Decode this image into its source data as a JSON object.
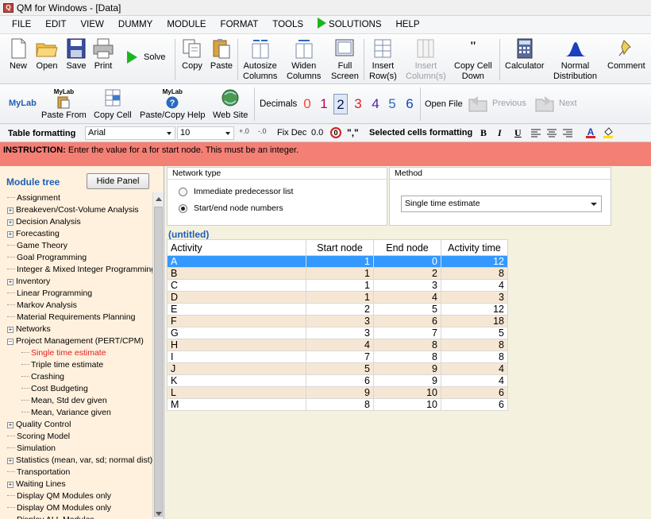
{
  "window": {
    "title": "QM for Windows - [Data]"
  },
  "menu": [
    "FILE",
    "EDIT",
    "VIEW",
    "DUMMY",
    "MODULE",
    "FORMAT",
    "TOOLS",
    "SOLUTIONS",
    "HELP"
  ],
  "toolbar": {
    "new": "New",
    "open": "Open",
    "save": "Save",
    "print": "Print",
    "solve": "Solve",
    "copy": "Copy",
    "paste": "Paste",
    "autosize": [
      "Autosize",
      "Columns"
    ],
    "widen": [
      "Widen",
      "Columns"
    ],
    "full": [
      "Full",
      "Screen"
    ],
    "insert_row": [
      "Insert",
      "Row(s)"
    ],
    "insert_col": [
      "Insert",
      "Column(s)"
    ],
    "copy_down": [
      "Copy Cell",
      "Down"
    ],
    "calculator": "Calculator",
    "normal": [
      "Normal",
      "Distribution"
    ],
    "comment": "Comment"
  },
  "toolbar2": {
    "mylab": "MyLab",
    "mylab_badge": "MyLab",
    "paste_from": "Paste From",
    "copy_cell": "Copy Cell",
    "paste_copy_help": "Paste/Copy Help",
    "web_site": "Web Site",
    "decimals": "Decimals",
    "decimal_options": [
      "0",
      "1",
      "2",
      "3",
      "4",
      "5",
      "6"
    ],
    "open_file": "Open File",
    "previous": "Previous",
    "next": "Next"
  },
  "formatbar": {
    "table_formatting": "Table formatting",
    "font": "Arial",
    "size": "10",
    "fix_dec": "Fix Dec",
    "fix_value": "0.0",
    "comma": "\",\"",
    "selected_cells": "Selected cells formatting",
    "bold": "B",
    "italic": "I",
    "underline": "U"
  },
  "instruction": {
    "label": "INSTRUCTION:",
    "text": "Enter the value for a for start node. This must be an integer."
  },
  "sidebar": {
    "title": "Module tree",
    "hide_button": "Hide Panel",
    "items": [
      {
        "label": "Assignment",
        "type": "leaf"
      },
      {
        "label": "Breakeven/Cost-Volume Analysis",
        "type": "exp"
      },
      {
        "label": "Decision Analysis",
        "type": "exp"
      },
      {
        "label": "Forecasting",
        "type": "exp"
      },
      {
        "label": "Game Theory",
        "type": "leaf"
      },
      {
        "label": "Goal Programming",
        "type": "leaf"
      },
      {
        "label": "Integer & Mixed Integer Programming",
        "type": "leaf"
      },
      {
        "label": "Inventory",
        "type": "exp"
      },
      {
        "label": "Linear Programming",
        "type": "leaf"
      },
      {
        "label": "Markov Analysis",
        "type": "leaf"
      },
      {
        "label": "Material Requirements Planning",
        "type": "leaf"
      },
      {
        "label": "Networks",
        "type": "exp"
      },
      {
        "label": "Project Management (PERT/CPM)",
        "type": "open"
      },
      {
        "label": "Single time estimate",
        "type": "child",
        "active": true
      },
      {
        "label": "Triple time estimate",
        "type": "child"
      },
      {
        "label": "Crashing",
        "type": "child"
      },
      {
        "label": "Cost Budgeting",
        "type": "child"
      },
      {
        "label": "Mean, Std dev given",
        "type": "child"
      },
      {
        "label": "Mean, Variance given",
        "type": "child"
      },
      {
        "label": "Quality Control",
        "type": "exp"
      },
      {
        "label": "Scoring Model",
        "type": "leaf"
      },
      {
        "label": "Simulation",
        "type": "leaf"
      },
      {
        "label": "Statistics (mean, var, sd; normal dist)",
        "type": "exp"
      },
      {
        "label": "Transportation",
        "type": "leaf"
      },
      {
        "label": "Waiting Lines",
        "type": "exp"
      },
      {
        "label": "Display QM Modules only",
        "type": "leaf"
      },
      {
        "label": "Display OM Modules only",
        "type": "leaf"
      },
      {
        "label": "Display ALL Modules",
        "type": "leaf"
      }
    ]
  },
  "network_type": {
    "title": "Network type",
    "options": [
      "Immediate predecessor list",
      "Start/end node numbers"
    ],
    "selected": 1
  },
  "method": {
    "title": "Method",
    "value": "Single time estimate"
  },
  "grid": {
    "title": "(untitled)",
    "headers": [
      "Activity",
      "Start node",
      "End node",
      "Activity time"
    ],
    "rows": [
      [
        "A",
        "1",
        "0",
        "12"
      ],
      [
        "B",
        "1",
        "2",
        "8"
      ],
      [
        "C",
        "1",
        "3",
        "4"
      ],
      [
        "D",
        "1",
        "4",
        "3"
      ],
      [
        "E",
        "2",
        "5",
        "12"
      ],
      [
        "F",
        "3",
        "6",
        "18"
      ],
      [
        "G",
        "3",
        "7",
        "5"
      ],
      [
        "H",
        "4",
        "8",
        "8"
      ],
      [
        "I",
        "7",
        "8",
        "8"
      ],
      [
        "J",
        "5",
        "9",
        "4"
      ],
      [
        "K",
        "6",
        "9",
        "4"
      ],
      [
        "L",
        "9",
        "10",
        "6"
      ],
      [
        "M",
        "8",
        "10",
        "6"
      ]
    ]
  },
  "colors": {
    "instruction_bg": "#f47f75",
    "sidebar_bg": "#fff1de",
    "selected_row": "#3399ff",
    "accent_blue": "#1f5fb5"
  }
}
